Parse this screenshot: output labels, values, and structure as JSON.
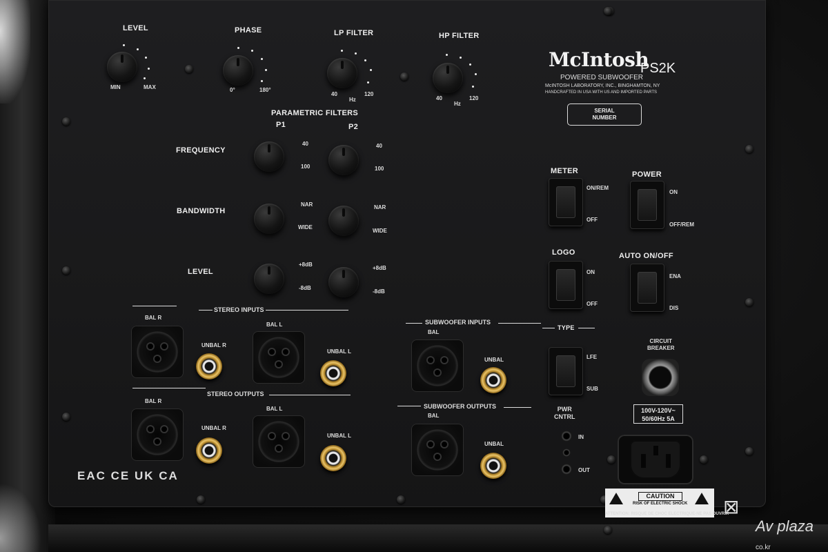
{
  "brand": "McIntosh",
  "model": "PS2K",
  "product_type": "POWERED SUBWOOFER",
  "maker_line": "McINTOSH LABORATORY, INC., BINGHAMTON, NY",
  "made_line": "HANDCRAFTED IN USA WITH US AND IMPORTED PARTS",
  "serial": "SERIAL\nNUMBER",
  "top_controls": {
    "level": {
      "title": "LEVEL",
      "min": "MIN",
      "max": "MAX"
    },
    "phase": {
      "title": "PHASE",
      "min": "0°",
      "max": "180°"
    },
    "lp": {
      "title": "LP FILTER",
      "min": "40",
      "unit": "Hz",
      "max": "120"
    },
    "hp": {
      "title": "HP FILTER",
      "min": "40",
      "unit": "Hz",
      "max": "120"
    }
  },
  "parametric": {
    "title": "PARAMETRIC FILTERS",
    "p1": "P1",
    "p2": "P2",
    "frequency": {
      "label": "FREQUENCY",
      "hi": "40",
      "lo": "100"
    },
    "bandwidth": {
      "label": "BANDWIDTH",
      "hi": "NAR",
      "lo": "WIDE"
    },
    "level": {
      "label": "LEVEL",
      "hi": "+8dB",
      "lo": "-8dB"
    }
  },
  "switches": {
    "meter": {
      "label": "METER",
      "top": "ON/REM",
      "bottom": "OFF"
    },
    "power": {
      "label": "POWER",
      "top": "ON",
      "bottom": "OFF/REM"
    },
    "logo": {
      "label": "LOGO",
      "top": "ON",
      "bottom": "OFF"
    },
    "auto": {
      "label": "AUTO ON/OFF",
      "top": "ENA",
      "bottom": "DIS"
    },
    "type": {
      "label": "TYPE",
      "top": "LFE",
      "bottom": "SUB"
    }
  },
  "io": {
    "stereo_inputs": "STEREO INPUTS",
    "stereo_outputs": "STEREO OUTPUTS",
    "sub_inputs": "SUBWOOFER INPUTS",
    "sub_outputs": "SUBWOOFER OUTPUTS",
    "bal_r": "BAL R",
    "bal_l": "BAL L",
    "unbal_r": "UNBAL R",
    "unbal_l": "UNBAL L",
    "bal": "BAL",
    "unbal": "UNBAL"
  },
  "power_control": {
    "title": "PWR\nCNTRL",
    "in": "IN",
    "out": "OUT"
  },
  "breaker": "CIRCUIT\nBREAKER",
  "rating": {
    "line1": "100V-120V~",
    "line2": "50/60Hz 5A"
  },
  "caution": {
    "title": "CAUTION",
    "sub": "RISK OF ELECTRIC SHOCK",
    "attention": "ATTENTION: RISQUE DE CHOC ELECTRIQUE-NE PAS OUVRIR"
  },
  "certs": "EAC CE UK CA",
  "watermark": {
    "main": "Av plaza",
    "sub": "co.kr"
  }
}
